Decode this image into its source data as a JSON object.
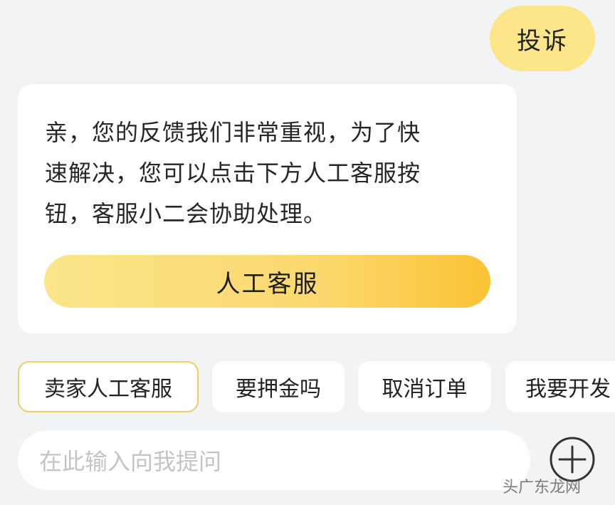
{
  "complaint": {
    "text": "投诉"
  },
  "reply": {
    "line1": "亲，您的反馈我们非常重视，为了快",
    "line2": "速解决，您可以点击下方人工客服按",
    "line3": "钮，客服小二会协助处理。",
    "button_label": "人工客服"
  },
  "quick_replies": [
    {
      "label": "卖家人工客服",
      "selected": true
    },
    {
      "label": "要押金吗",
      "selected": false
    },
    {
      "label": "取消订单",
      "selected": false
    },
    {
      "label": "我要开发",
      "selected": false
    }
  ],
  "input": {
    "placeholder": "在此输入向我提问"
  },
  "icons": {
    "plus": "plus-circle-icon"
  },
  "watermark": {
    "text": "头广东龙网"
  },
  "colors": {
    "page_background": "#f2f3f5",
    "user_bubble": "#fde589",
    "button_gradient_start": "#fbe48a",
    "button_gradient_end": "#fbc334",
    "selected_chip_border": "#f2cf63"
  }
}
